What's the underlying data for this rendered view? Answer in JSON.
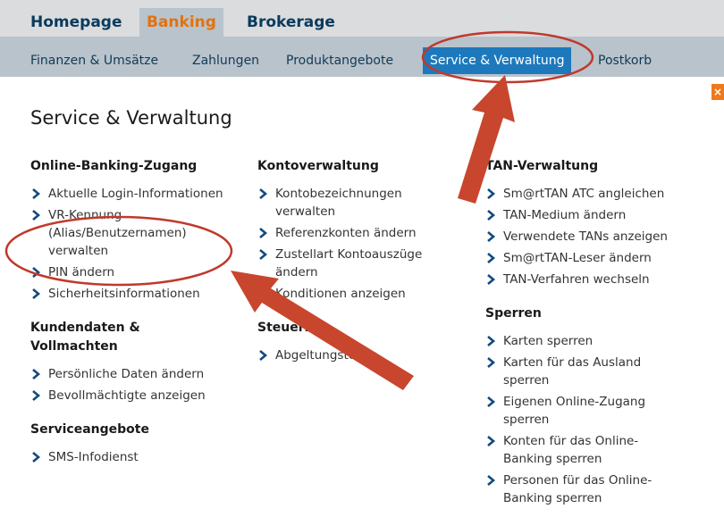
{
  "topnav": {
    "tabs": [
      {
        "label": "Homepage"
      },
      {
        "label": "Banking"
      },
      {
        "label": "Brokerage"
      }
    ]
  },
  "subnav": {
    "items": [
      {
        "label": "Finanzen & Umsätze"
      },
      {
        "label": "Zahlungen"
      },
      {
        "label": "Produktangebote"
      },
      {
        "label": "Service & Verwaltung"
      },
      {
        "label": "Postkorb"
      }
    ]
  },
  "close_label": "×",
  "page_title": "Service & Verwaltung",
  "columns": [
    {
      "sections": [
        {
          "title": "Online-Banking-Zugang",
          "links": [
            "Aktuelle Login-Informationen",
            "VR-Kennung (Alias/Benutzernamen) verwalten",
            "PIN ändern",
            "Sicherheitsinformationen"
          ]
        },
        {
          "title": "Kundendaten & Vollmachten",
          "links": [
            "Persönliche Daten ändern",
            "Bevollmächtigte anzeigen"
          ]
        },
        {
          "title": "Serviceangebote",
          "links": [
            "SMS-Infodienst"
          ]
        }
      ]
    },
    {
      "sections": [
        {
          "title": "Kontoverwaltung",
          "links": [
            "Kontobezeichnungen verwalten",
            "Referenzkonten ändern",
            "Zustellart Kontoauszüge ändern",
            "Konditionen anzeigen"
          ]
        },
        {
          "title": "Steuern",
          "links": [
            "Abgeltungsteuer"
          ]
        }
      ]
    },
    {
      "sections": [
        {
          "title": "TAN-Verwaltung",
          "links": [
            "Sm@rtTAN ATC angleichen",
            "TAN-Medium ändern",
            "Verwendete TANs anzeigen",
            "Sm@rtTAN-Leser ändern",
            "TAN-Verfahren wechseln"
          ]
        },
        {
          "title": "Sperren",
          "links": [
            "Karten sperren",
            "Karten für das Ausland sperren",
            "Eigenen Online-Zugang sperren",
            "Konten für das Online-Banking sperren",
            "Personen für das Online-Banking sperren"
          ]
        }
      ]
    }
  ],
  "colors": {
    "brand_orange": "#e2720f",
    "nav_text": "#0b3a5c",
    "active_blue": "#1d79bc",
    "chevron": "#124a80",
    "annotation_red": "#c0392b"
  }
}
